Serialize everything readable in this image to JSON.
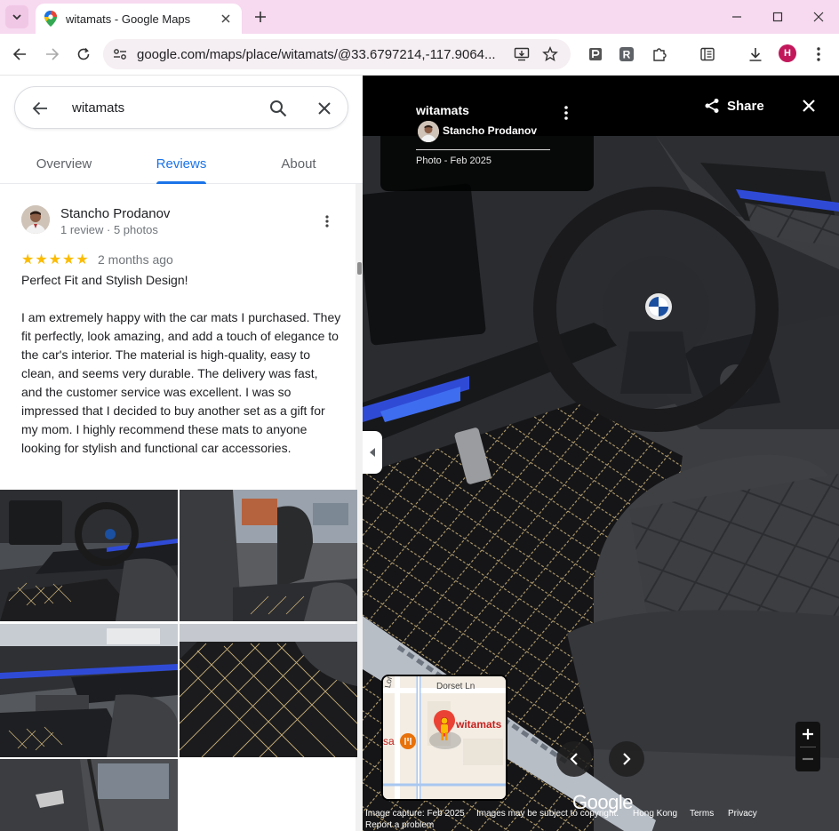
{
  "browser": {
    "tab_title": "witamats - Google Maps",
    "url": "google.com/maps/place/witamats/@33.6797214,-117.9064...",
    "profile_initial": "H",
    "ext_r_label": "R"
  },
  "search": {
    "value": "witamats"
  },
  "tabs": [
    {
      "label": "Overview"
    },
    {
      "label": "Reviews"
    },
    {
      "label": "About"
    }
  ],
  "review": {
    "author": "Stancho Prodanov",
    "meta": "1 review · 5 photos",
    "stars": "★★★★★",
    "rating": 5,
    "date": "2 months ago",
    "title": "Perfect Fit and Stylish Design!",
    "body": "I am extremely happy with the car mats I purchased. They fit perfectly, look amazing, and add a touch of elegance to the car's interior. The material is high-quality, easy to clean, and seems very durable. The delivery was fast, and the customer service was excellent. I was so impressed that I decided to buy another set as a gift for my mom. I highly recommend these mats to anyone looking for stylish and functional car accessories."
  },
  "viewer": {
    "title": "witamats",
    "author": "Stancho Prodanov",
    "photo_date": "Photo - Feb 2025",
    "share_label": "Share",
    "minimap": {
      "street": "Dorset Ln",
      "street_vertical": "Loren",
      "place_label": "witamats",
      "partial_label": "sa"
    },
    "google_logo": "Google",
    "footer": {
      "capture": "Image capture: Feb 2025",
      "disclaimer": "Images may be subject to copyright.",
      "region": "Hong Kong",
      "terms": "Terms",
      "privacy": "Privacy",
      "report": "Report a problem"
    }
  },
  "colors": {
    "accent": "#1a73e8",
    "star": "#fbbc04",
    "tabbar": "#f7d9f0",
    "mat_stitch": "#c9b07a"
  }
}
